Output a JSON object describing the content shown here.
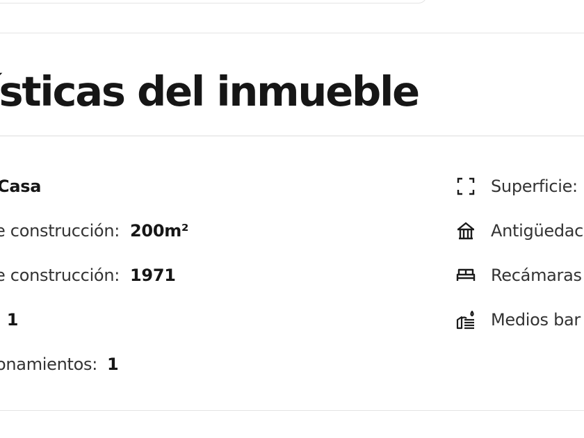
{
  "section": {
    "title": "cterísticas del inmueble"
  },
  "left_features": [
    {
      "label": "",
      "value": "Casa"
    },
    {
      "label": "e construcción:",
      "value": "200m²"
    },
    {
      "label": "e construcción:",
      "value": "1971"
    },
    {
      "label": ":",
      "value": "1"
    },
    {
      "label": "onamientos:",
      "value": "1"
    }
  ],
  "right_features": [
    {
      "icon": "expand-icon",
      "label": "Superficie:"
    },
    {
      "icon": "building-icon",
      "label": "Antigüedac"
    },
    {
      "icon": "bed-icon",
      "label": "Recámaras"
    },
    {
      "icon": "shower-icon",
      "label": "Medios bar"
    }
  ]
}
